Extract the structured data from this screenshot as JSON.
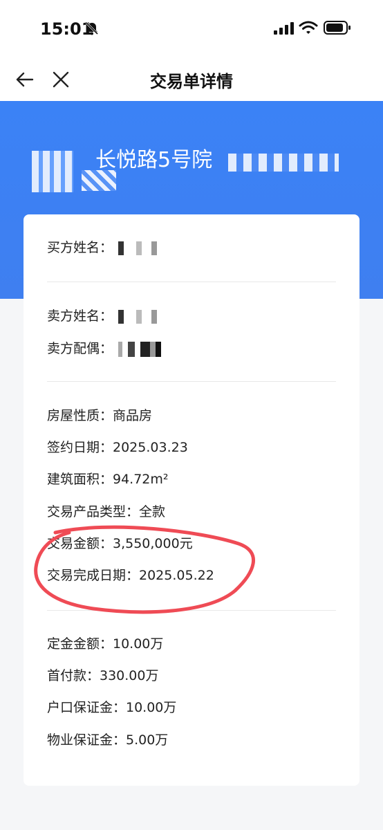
{
  "status_bar": {
    "time": "15:01"
  },
  "nav": {
    "title": "交易单详情"
  },
  "hero": {
    "address_visible": "长悦路5号院"
  },
  "buyer": {
    "name_label": "买方姓名："
  },
  "seller": {
    "name_label": "卖方姓名：",
    "spouse_label": "卖方配偶："
  },
  "house": {
    "property_type": "房屋性质：商品房",
    "sign_date": "签约日期：2025.03.23",
    "building_area": "建筑面积：94.72m²",
    "product_type": "交易产品类型：全款",
    "amount": "交易金额：3,550,000元",
    "complete_date": "交易完成日期：2025.05.22"
  },
  "payments": {
    "deposit": "定金金额：10.00万",
    "down_payment": "首付款：330.00万",
    "hukou_deposit": "户口保证金：10.00万",
    "property_deposit": "物业保证金：5.00万"
  },
  "colors": {
    "hero_blue": "#3f7ff0",
    "annotation_red": "#ef4b55"
  }
}
